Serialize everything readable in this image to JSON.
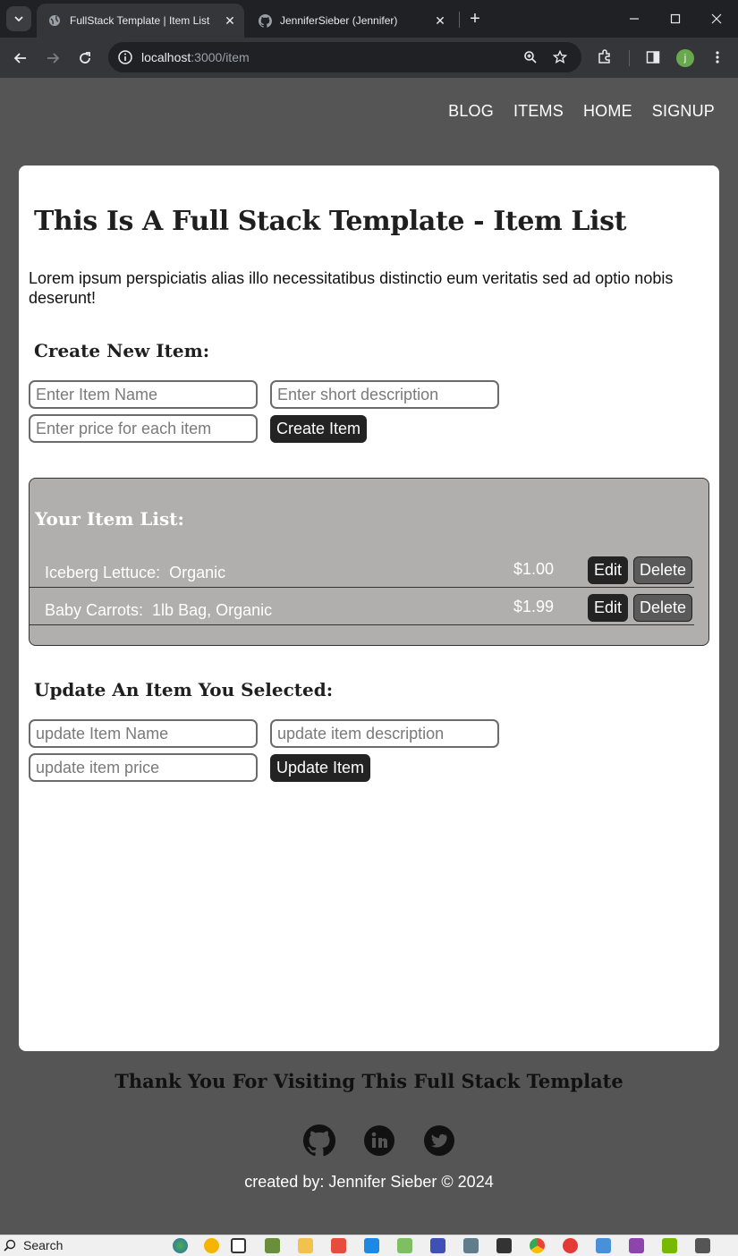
{
  "browser": {
    "tabs": [
      {
        "title": "FullStack Template | Item List",
        "active": true
      },
      {
        "title": "JenniferSieber (Jennifer)",
        "active": false
      }
    ],
    "url_host": "localhost",
    "url_path": ":3000/item",
    "profile_initial": "j"
  },
  "nav": {
    "links": [
      "BLOG",
      "ITEMS",
      "HOME",
      "SIGNUP"
    ]
  },
  "page": {
    "title": "This Is A Full Stack Template - Item List",
    "intro": "Lorem ipsum perspiciatis alias illo necessitatibus distinctio eum veritatis sed ad optio nobis deserunt!"
  },
  "create_form": {
    "heading": "Create New Item:",
    "name_placeholder": "Enter Item Name",
    "description_placeholder": "Enter short description",
    "price_placeholder": "Enter price for each item",
    "submit_label": "Create Item"
  },
  "item_list": {
    "heading": "Your Item List:",
    "items": [
      {
        "name": "Iceberg Lettuce:  Organic",
        "price": "$1.00",
        "edit_label": "Edit",
        "delete_label": "Delete"
      },
      {
        "name": "Baby Carrots:  1lb Bag, Organic",
        "price": "$1.99",
        "edit_label": "Edit",
        "delete_label": "Delete"
      }
    ]
  },
  "update_form": {
    "heading": "Update An Item You Selected:",
    "name_placeholder": "update Item Name",
    "description_placeholder": "update item description",
    "price_placeholder": "update item price",
    "submit_label": "Update Item"
  },
  "footer": {
    "title": "Thank You For Visiting This Full Stack Template",
    "social_icons": [
      "github-icon",
      "linkedin-icon",
      "twitter-icon"
    ],
    "credit": "created by: Jennifer Sieber © 2024"
  },
  "taskbar": {
    "search_label": "Search"
  },
  "colors": {
    "page_bg": "#555555",
    "card_bg": "#ffffff",
    "list_bg": "#b0afad",
    "button_dark": "#232323",
    "delete_button": "#5a5a5a"
  }
}
